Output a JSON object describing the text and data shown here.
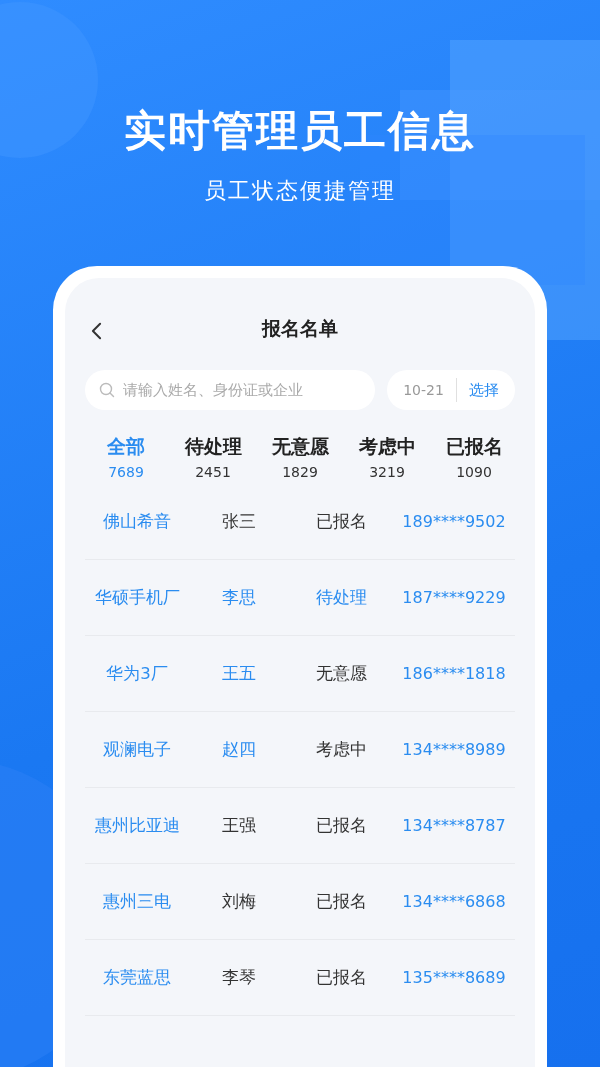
{
  "headline": "实时管理员工信息",
  "subheadline": "员工状态便捷管理",
  "screen": {
    "title": "报名名单",
    "search": {
      "placeholder": "请输入姓名、身份证或企业"
    },
    "date_filter": {
      "value": "10-21",
      "button": "选择"
    },
    "tabs": [
      {
        "label": "全部",
        "count": "7689",
        "selected": true
      },
      {
        "label": "待处理",
        "count": "2451",
        "selected": false
      },
      {
        "label": "无意愿",
        "count": "1829",
        "selected": false
      },
      {
        "label": "考虑中",
        "count": "3219",
        "selected": false
      },
      {
        "label": "已报名",
        "count": "1090",
        "selected": false
      }
    ],
    "rows": [
      {
        "company": "佛山希音",
        "name": "张三",
        "name_highlighted": false,
        "status": "已报名",
        "status_highlighted": false,
        "phone": "189****9502"
      },
      {
        "company": "华硕手机厂",
        "name": "李思",
        "name_highlighted": true,
        "status": "待处理",
        "status_highlighted": true,
        "phone": "187****9229"
      },
      {
        "company": "华为3厂",
        "name": "王五",
        "name_highlighted": true,
        "status": "无意愿",
        "status_highlighted": false,
        "phone": "186****1818"
      },
      {
        "company": "观澜电子",
        "name": "赵四",
        "name_highlighted": true,
        "status": "考虑中",
        "status_highlighted": false,
        "phone": "134****8989"
      },
      {
        "company": "惠州比亚迪",
        "name": "王强",
        "name_highlighted": false,
        "status": "已报名",
        "status_highlighted": false,
        "phone": "134****8787"
      },
      {
        "company": "惠州三电",
        "name": "刘梅",
        "name_highlighted": false,
        "status": "已报名",
        "status_highlighted": false,
        "phone": "134****6868"
      },
      {
        "company": "东莞蓝思",
        "name": "李琴",
        "name_highlighted": false,
        "status": "已报名",
        "status_highlighted": false,
        "phone": "135****8689"
      }
    ]
  }
}
